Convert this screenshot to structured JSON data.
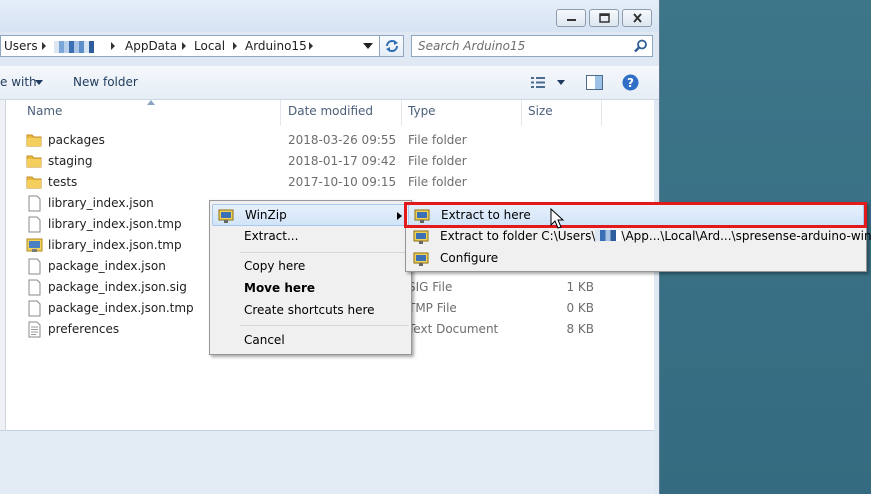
{
  "window": {
    "controls": {
      "minimize": "minimize",
      "maximize": "maximize",
      "close": "close"
    }
  },
  "address": {
    "crumbs": [
      "Users",
      "AppData",
      "Local",
      "Arduino15"
    ],
    "dropdown_icon": "chevron-down-icon",
    "refresh_icon": "refresh-icon"
  },
  "search": {
    "placeholder": "Search Arduino15",
    "icon": "magnifier-icon"
  },
  "toolbar": {
    "share_label": "e with",
    "new_folder_label": "New folder"
  },
  "columns": {
    "name": "Name",
    "date": "Date modified",
    "type": "Type",
    "size": "Size"
  },
  "files": [
    {
      "name": "packages",
      "date": "2018-03-26 09:55",
      "type": "File folder",
      "size": "",
      "icon": "folder-icon"
    },
    {
      "name": "staging",
      "date": "2018-01-17 09:42",
      "type": "File folder",
      "size": "",
      "icon": "folder-icon"
    },
    {
      "name": "tests",
      "date": "2017-10-10 09:15",
      "type": "File folder",
      "size": "",
      "icon": "folder-icon"
    },
    {
      "name": "library_index.json",
      "date": "",
      "type": "",
      "size": "",
      "icon": "file-icon"
    },
    {
      "name": "library_index.json.tmp",
      "date": "",
      "type": "",
      "size": "",
      "icon": "file-icon"
    },
    {
      "name": "library_index.json.tmp",
      "date": "",
      "type": "",
      "size": "",
      "icon": "zip-file-icon"
    },
    {
      "name": "package_index.json",
      "date": "",
      "type": "",
      "size": "",
      "icon": "file-icon"
    },
    {
      "name": "package_index.json.sig",
      "date": "",
      "type": "SIG File",
      "size": "1 KB",
      "icon": "file-icon"
    },
    {
      "name": "package_index.json.tmp",
      "date": "",
      "type": "TMP File",
      "size": "0 KB",
      "icon": "file-icon"
    },
    {
      "name": "preferences",
      "date": "",
      "type": "Text Document",
      "size": "8 KB",
      "icon": "text-file-icon"
    }
  ],
  "context_menu": {
    "items": [
      "WinZip",
      "Extract...",
      "Copy here",
      "Move here",
      "Create shortcuts here",
      "Cancel"
    ]
  },
  "submenu": {
    "extract_here": "Extract to here",
    "extract_folder_prefix": "Extract to folder C:\\Users\\",
    "extract_folder_suffix": "\\App...\\Local\\Ard...\\spresense-arduino-windows",
    "configure": "Configure"
  },
  "colors": {
    "highlight_border": "#e11b1b",
    "desktop": "#3e7385",
    "folder": "#e8b93c"
  }
}
